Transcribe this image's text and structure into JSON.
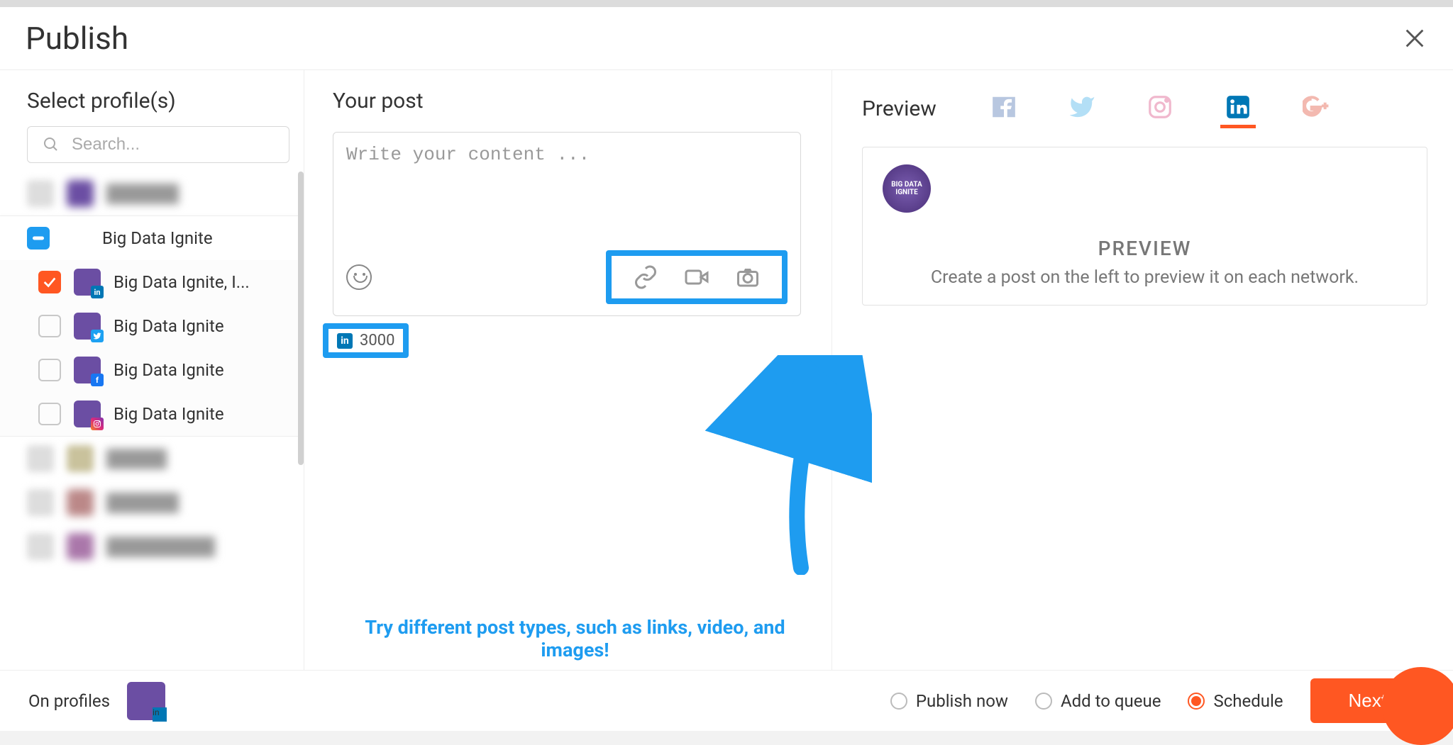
{
  "header": {
    "title": "Publish"
  },
  "sidebar": {
    "title": "Select profile(s)",
    "search_placeholder": "Search...",
    "profiles": [
      {
        "label": "██████",
        "blurred": true
      },
      {
        "label": "Big Data Ignite",
        "state": "indeterminate",
        "grid": true
      },
      {
        "label": "Big Data Ignite, I...",
        "state": "checked",
        "network": "linkedin"
      },
      {
        "label": "Big Data Ignite",
        "state": "unchecked",
        "network": "twitter"
      },
      {
        "label": "Big Data Ignite",
        "state": "unchecked",
        "network": "facebook"
      },
      {
        "label": "Big Data Ignite",
        "state": "unchecked",
        "network": "instagram"
      },
      {
        "label": "█████",
        "blurred": true
      },
      {
        "label": "██████",
        "blurred": true
      },
      {
        "label": "█████████",
        "blurred": true
      }
    ]
  },
  "composer": {
    "title": "Your post",
    "placeholder": "Write your content ...",
    "char_count": "3000",
    "tip": "Try different post types, such as links, video, and images!"
  },
  "preview": {
    "title": "Preview",
    "card_title": "PREVIEW",
    "card_msg": "Create a post on the left to preview it on each network.",
    "avatar_text": "BIG DATA IGNITE"
  },
  "footer": {
    "on_profiles": "On profiles",
    "publish_now": "Publish now",
    "add_to_queue": "Add to queue",
    "schedule": "Schedule",
    "next": "Next"
  }
}
